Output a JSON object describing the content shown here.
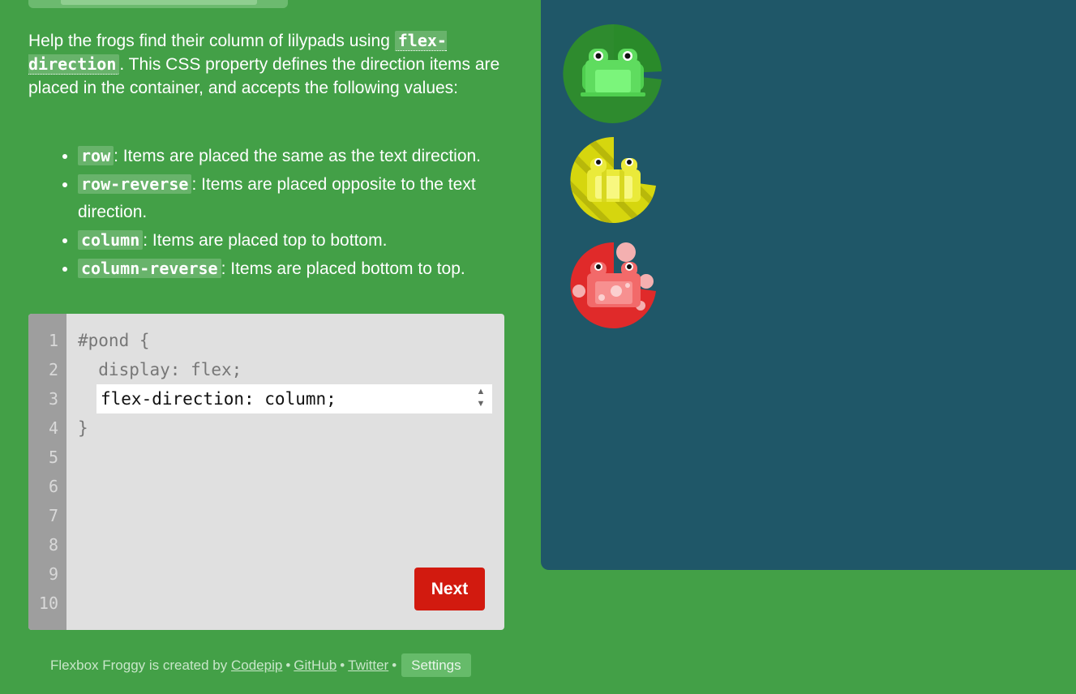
{
  "instructions": {
    "intro_before": "Help the frogs find their column of lilypads using ",
    "property": "flex-direction",
    "intro_after": ". This CSS property defines the direction items are placed in the container, and accepts the following values:",
    "values": [
      {
        "code": "row",
        "text": ": Items are placed the same as the text direction."
      },
      {
        "code": "row-reverse",
        "text": ": Items are placed opposite to the text direction."
      },
      {
        "code": "column",
        "text": ": Items are placed top to bottom."
      },
      {
        "code": "column-reverse",
        "text": ": Items are placed bottom to top."
      }
    ]
  },
  "editor": {
    "line_numbers": [
      "1",
      "2",
      "3",
      "4",
      "5",
      "6",
      "7",
      "8",
      "9",
      "10"
    ],
    "line1": "#pond {",
    "line2": "  display: flex;",
    "input_value": "flex-direction: column;",
    "line4": "}",
    "next_label": "Next"
  },
  "footer": {
    "created_by": "Flexbox Froggy is created by",
    "codepip": "Codepip",
    "github": "GitHub",
    "twitter": "Twitter",
    "bullet": "•",
    "settings": "Settings"
  },
  "pond": {
    "background": "#1f5768",
    "frogs": [
      {
        "color": "green",
        "pad_color": "#2e8b2e",
        "body_color": "#7bed7b"
      },
      {
        "color": "yellow",
        "pad_color": "#d4d40a",
        "body_color": "#f3f36a"
      },
      {
        "color": "red",
        "pad_color": "#e02a2a",
        "body_color": "#f07878"
      }
    ]
  }
}
